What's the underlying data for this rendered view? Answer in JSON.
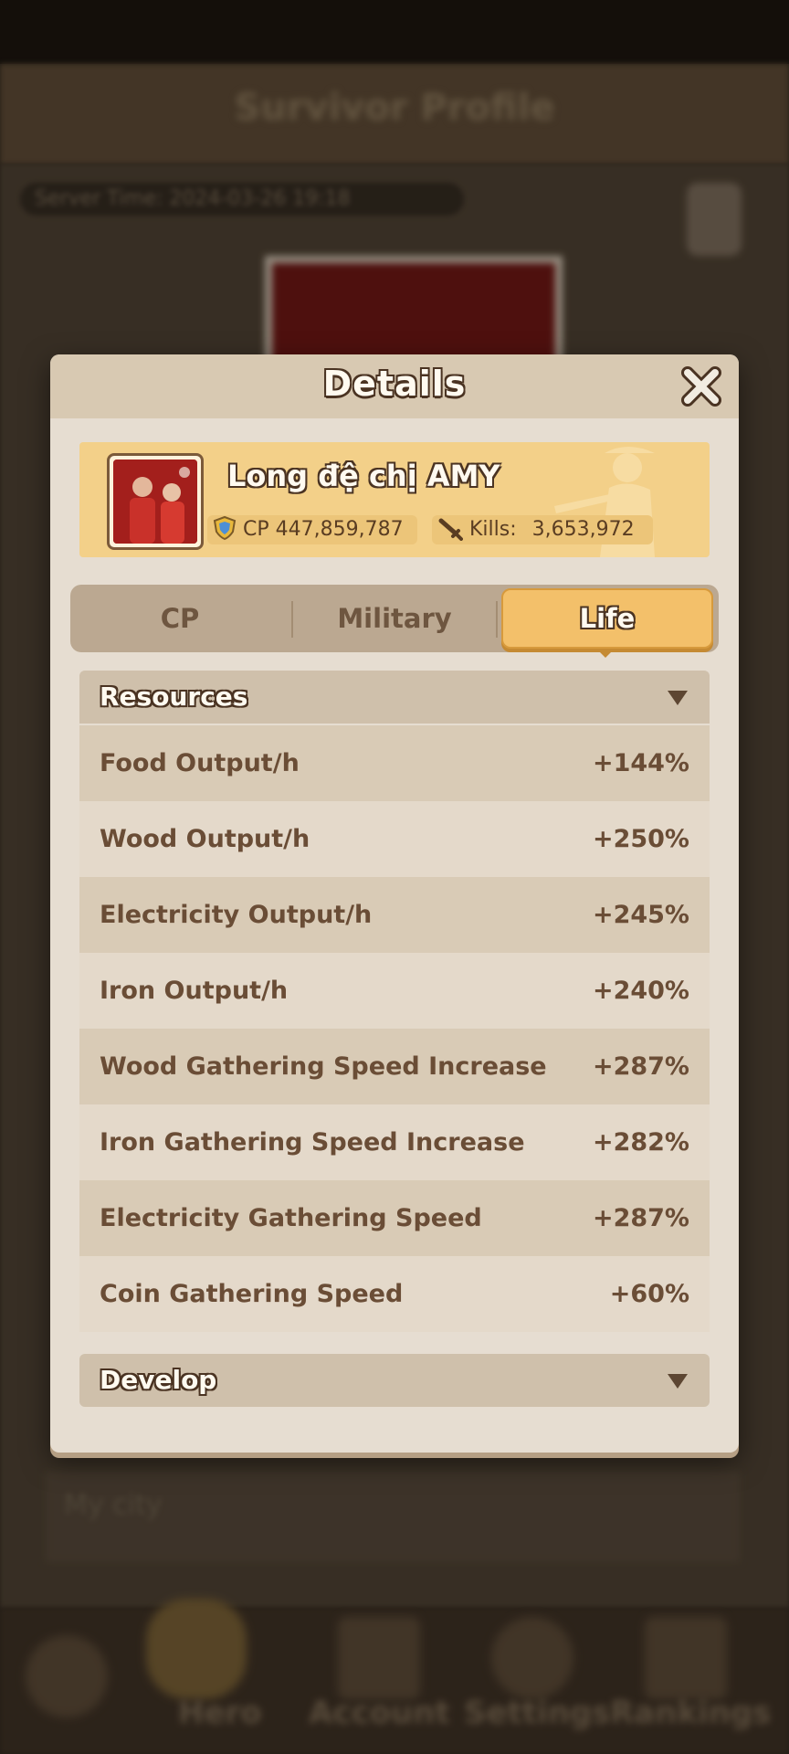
{
  "background": {
    "header_title": "Survivor Profile",
    "server_time": "Server Time: 2024-03-26 19:18",
    "row_text": "My city",
    "nav_labels": [
      "Hero",
      "Account",
      "Settings",
      "Rankings"
    ]
  },
  "modal": {
    "title": "Details",
    "close_icon": "close-icon"
  },
  "profile": {
    "name": "Long đệ chị AMY",
    "cp_label": "CP",
    "cp_value": "447,859,787",
    "kills_label": "Kills:",
    "kills_value": "3,653,972"
  },
  "tabs": [
    {
      "label": "CP",
      "active": false
    },
    {
      "label": "Military",
      "active": false
    },
    {
      "label": "Life",
      "active": true
    }
  ],
  "sections": {
    "resources": {
      "title": "Resources",
      "rows": [
        {
          "label": "Food Output/h",
          "value": "+144%"
        },
        {
          "label": "Wood Output/h",
          "value": "+250%"
        },
        {
          "label": "Electricity Output/h",
          "value": "+245%"
        },
        {
          "label": "Iron Output/h",
          "value": "+240%"
        },
        {
          "label": "Wood Gathering Speed Increase",
          "value": "+287%"
        },
        {
          "label": "Iron Gathering Speed Increase",
          "value": "+282%"
        },
        {
          "label": "Electricity Gathering Speed",
          "value": "+287%"
        },
        {
          "label": "Coin Gathering Speed",
          "value": "+60%"
        }
      ]
    },
    "develop": {
      "title": "Develop"
    }
  },
  "colors": {
    "accent_tab": "#f3c06a",
    "banner": "#f3d089",
    "text": "#6a4d36"
  }
}
